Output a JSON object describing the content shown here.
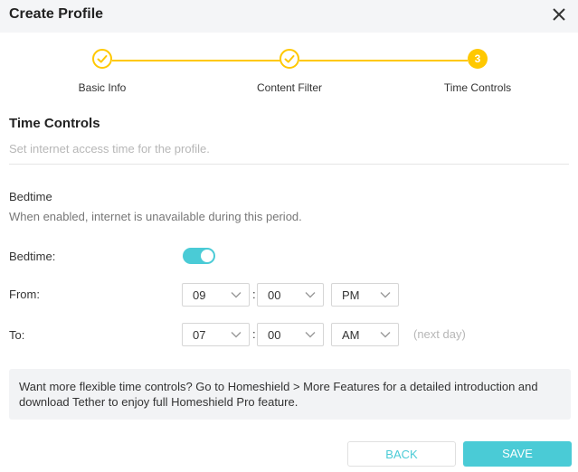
{
  "dialog": {
    "title": "Create Profile"
  },
  "stepper": {
    "steps": [
      {
        "label": "Basic Info",
        "state": "done"
      },
      {
        "label": "Content Filter",
        "state": "done"
      },
      {
        "label": "Time Controls",
        "state": "current",
        "number": "3"
      }
    ],
    "accent": "#ffc800"
  },
  "section": {
    "title": "Time Controls",
    "description": "Set internet access time for the profile."
  },
  "bedtime": {
    "heading": "Bedtime",
    "description": "When enabled, internet is unavailable during this period.",
    "toggle_label": "Bedtime:",
    "enabled": true,
    "from_label": "From:",
    "from": {
      "hour": "09",
      "minute": "00",
      "period": "PM"
    },
    "to_label": "To:",
    "to": {
      "hour": "07",
      "minute": "00",
      "period": "AM"
    },
    "next_day": "(next day)",
    "separator": ":"
  },
  "info": {
    "text": "Want more flexible time controls? Go to Homeshield > More Features for a detailed introduction and download Tether to enjoy full Homeshield Pro feature."
  },
  "buttons": {
    "back": "BACK",
    "save": "SAVE"
  },
  "colors": {
    "teal": "#4acbd6",
    "yellow": "#ffc800"
  }
}
